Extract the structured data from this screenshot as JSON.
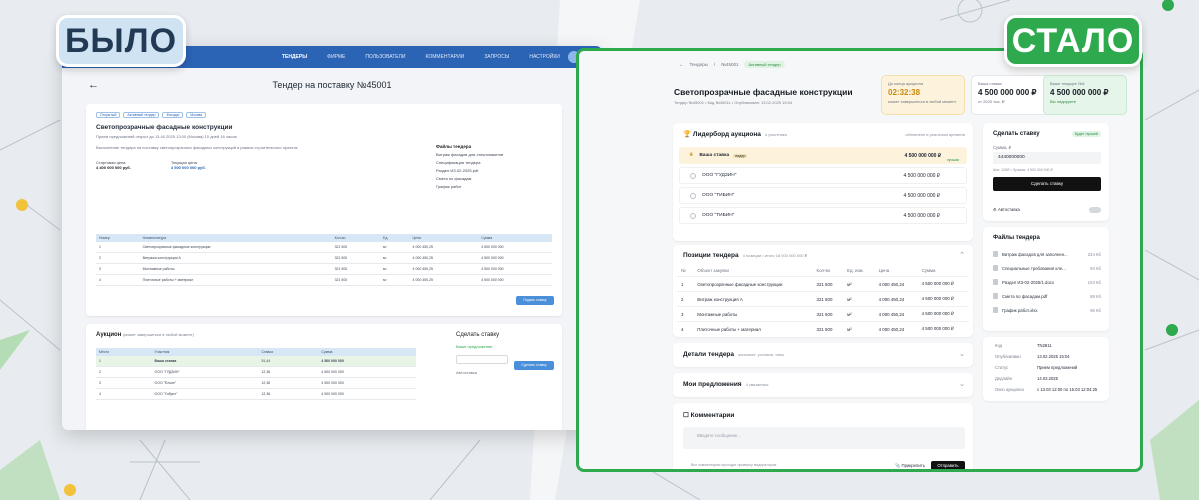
{
  "badges": {
    "before": "БЫЛО",
    "after": "СТАЛО"
  },
  "colors": {
    "accent_green": "#2fa94e",
    "old_blue": "#2b63b5",
    "old_badge": "#cfe3f3"
  },
  "old": {
    "nav": [
      "ТЕНДЕРЫ",
      "ФИРМЕ",
      "ПОЛЬЗОВАТЕЛИ",
      "КОММЕНТАРИИ",
      "ЗАПРОСЫ",
      "НАСТРОЙКИ"
    ],
    "title": "Тендер на поставку №45001",
    "tags": [
      "Открытый",
      "Активный тендер",
      "Фасады",
      "Москва"
    ],
    "tender_name": "Светопрозрачные фасадные конструкции",
    "meta": "Прием предложений открыт до 13.40.2025 13:00 (Москва) 10 дней 16 часов",
    "description": "Выполнение тендера на поставку светопрозрачных фасадных конструкций в рамках строительного проекта.",
    "fields": [
      {
        "label": "Стартовая цена",
        "value": "4 400 000 000 руб."
      },
      {
        "label": "Текущая цена",
        "value": "4 500 000 000 руб."
      }
    ],
    "info_title": "Файлы тендера",
    "info_items": [
      "Витраж фасадов для стеклопакетов",
      "Спецификация тендера",
      "Раздел ИЗ-02-2025.pdf",
      "Смета по фасадам",
      "График работ"
    ],
    "table_headers": [
      "Номер",
      "Номенклатура",
      "Кол-во",
      "Ед.",
      "Цена",
      "Сумма"
    ],
    "table_rows": [
      {
        "n": "1",
        "name": "Светопрозрачные фасадные конструкции",
        "qty": "321 500",
        "unit": "м²",
        "price": "4 000 450,25",
        "sum": "4 500 000 000"
      },
      {
        "n": "2",
        "name": "Витражи конструкция А",
        "qty": "321 500",
        "unit": "м²",
        "price": "4 000 450,25",
        "sum": "4 500 000 000"
      },
      {
        "n": "3",
        "name": "Монтажные работы",
        "qty": "321 500",
        "unit": "м²",
        "price": "4 000 450,25",
        "sum": "4 500 000 000"
      },
      {
        "n": "4",
        "name": "Плиточные работы + материал",
        "qty": "321 500",
        "unit": "м²",
        "price": "4 000 450,25",
        "sum": "4 500 000 000"
      }
    ],
    "save_label": "Подать ставку",
    "auction_title": "Аукцион",
    "auction_hint": "(может завершиться в любой момент)",
    "auction_headers": [
      "Место",
      "Участник",
      "Ставка",
      "Сумма"
    ],
    "auction_rows": [
      {
        "n": "1",
        "name": "Ваша ставка",
        "pct": "51,44",
        "sum": "4 500 000 000"
      },
      {
        "n": "2",
        "name": "ООО \"ГУДЗИН\"",
        "pct": "12,36",
        "sum": "4 500 000 000"
      },
      {
        "n": "3",
        "name": "ООО \"Ёлкин\"",
        "pct": "12,36",
        "sum": "4 500 000 000"
      },
      {
        "n": "4",
        "name": "ООО \"Гибрит\"",
        "pct": "12,36",
        "sum": "4 500 000 000"
      }
    ],
    "bid_title": "Сделать ставку",
    "bid_sub": "Ваше предложение",
    "bid_button": "Сделать ставку",
    "autobid": "Автоставка"
  },
  "new": {
    "breadcrumb": [
      "Тендеры",
      "№45001"
    ],
    "status_pill": "Активный тендер",
    "title": "Светопрозрачные фасадные конструкции",
    "subtitle": "Тендер №45001 • Код №45011 • Опубликован: 13.02.2025 15:04",
    "kpis": [
      {
        "label": "До конца аукциона",
        "value": "02:32:38",
        "note": "может завершиться в любой момент"
      },
      {
        "label": "Ваша ставка",
        "value": "4 500 000 000 ₽",
        "note": "от 2025 тыс. ₽"
      },
      {
        "label": "Ваше текущее №4",
        "value": "4 500 000 000 ₽",
        "note": "Вы лидируете"
      }
    ],
    "auction": {
      "title": "Лидерборд аукциона",
      "count": "4 участника",
      "hint": "обновлено в реальном времени",
      "rows": [
        {
          "name": "Ваша ставка",
          "tag": "лидер",
          "time": "сегодня 12:24",
          "amount": "4 500 000 000 ₽",
          "status": "лучшая"
        },
        {
          "name": "ООО \"ГУДЗИН\"",
          "time": "сегодня 12:21",
          "amount": "4 500 000 000 ₽"
        },
        {
          "name": "ООО \"ТИБИН\"",
          "time": "сегодня 12:18",
          "amount": "4 500 000 000 ₽"
        },
        {
          "name": "ООО \"ТИБИН\"",
          "time": "сегодня 12:15",
          "amount": "4 500 000 000 ₽"
        }
      ]
    },
    "positions": {
      "title": "Позиции тендера",
      "hint": "4 позиции • итого 18 000 000 000 ₽",
      "headers": [
        "№",
        "Объект закупки",
        "Кол-во",
        "Ед. изм.",
        "Цена",
        "Сумма"
      ],
      "rows": [
        {
          "n": "1",
          "name": "Светопрозрачные фасадные конструкции",
          "qty": "321 500",
          "unit": "м²",
          "price": "4 000 450,24",
          "sum": "4 500 000 000 ₽"
        },
        {
          "n": "2",
          "name": "Витраж конструкция А",
          "qty": "321 500",
          "unit": "м²",
          "price": "4 000 450,24",
          "sum": "4 500 000 000 ₽"
        },
        {
          "n": "3",
          "name": "Монтажные работы",
          "qty": "321 500",
          "unit": "м²",
          "price": "4 000 450,24",
          "sum": "4 500 000 000 ₽"
        },
        {
          "n": "4",
          "name": "Плиточные работы + материал",
          "qty": "321 500",
          "unit": "м²",
          "price": "4 000 450,24",
          "sum": "4 500 000 000 ₽"
        }
      ]
    },
    "details": {
      "title": "Детали тендера",
      "hint": "описание, условия, типы"
    },
    "proposals": {
      "title": "Мои предложения",
      "hint": "4 связанных"
    },
    "comments": {
      "title": "Комментарии",
      "placeholder": "Введите сообщение...",
      "footer": "Все комментарии проходят проверку модератором",
      "attach": "Прикрепить",
      "send": "Отправить"
    },
    "bid": {
      "title": "Сделать ставку",
      "pill": "Будет лучшей",
      "label": "Сумма, ₽",
      "value": "4440000000",
      "hint": "Шаг: 100₽ • Лучшая: 4 500 000 000 ₽",
      "button": "Сделать ставку",
      "autobid": "Автоставка"
    },
    "files": {
      "title": "Файлы тендера",
      "items": [
        {
          "name": "Витраж фасадов для заполнен...",
          "size": "234 Кб"
        },
        {
          "name": "Специальные требования кле...",
          "size": "94 Кб"
        },
        {
          "name": "Раздел ИЗ-02-2025/1.docx",
          "size": "103 Кб"
        },
        {
          "name": "Смета по фасадам.pdf",
          "size": "88 Кб"
        },
        {
          "name": "График работ.xlsx",
          "size": "96 Кб"
        }
      ]
    },
    "info": [
      {
        "k": "Код",
        "v": "TN2811"
      },
      {
        "k": "Опубликован",
        "v": "13.02.2025 15:04"
      },
      {
        "k": "Статус",
        "v": "Прием предложений"
      },
      {
        "k": "Дедлайн",
        "v": "14.03.2025"
      },
      {
        "k": "Окно аукциона",
        "v": "с 13.03 12:00 по 15.03 12:04:25"
      }
    ]
  }
}
